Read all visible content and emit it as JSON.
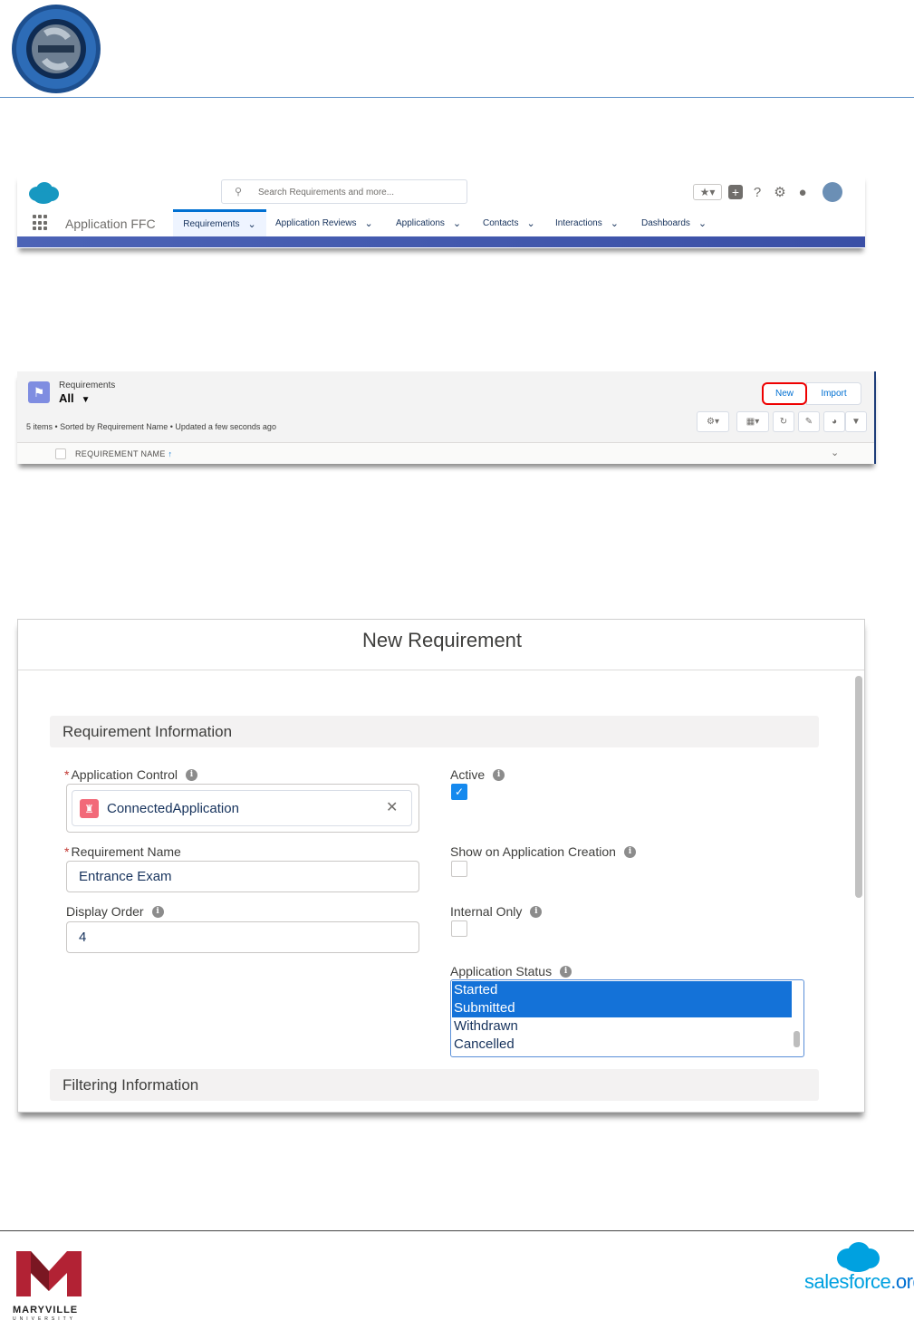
{
  "colors": {
    "brand_blue": "#0070d2",
    "nav_band": "#3a4fa6",
    "highlight_red": "#e00000",
    "selected_option": "#1472d8",
    "object_icon": "#7f8de1",
    "lookup_icon": "#f26979"
  },
  "top_nav": {
    "search_placeholder": "Search Requirements and more...",
    "app_name": "Application FFC",
    "tabs": [
      {
        "label": "Requirements",
        "active": true
      },
      {
        "label": "Application Reviews"
      },
      {
        "label": "Applications"
      },
      {
        "label": "Contacts"
      },
      {
        "label": "Interactions"
      },
      {
        "label": "Dashboards"
      }
    ],
    "icons": [
      "favorites-icon",
      "global-add-icon",
      "help-icon",
      "setup-gear-icon",
      "notifications-bell-icon",
      "user-avatar"
    ]
  },
  "list_view": {
    "object_label": "Requirements",
    "view_name": "All",
    "meta": "5 items • Sorted by Requirement Name • Updated a few seconds ago",
    "new_button": "New",
    "import_button": "Import",
    "column_header": "REQUIREMENT NAME",
    "sort_indicator": "↑"
  },
  "modal": {
    "title": "New Requirement",
    "section_requirement": "Requirement Information",
    "section_filtering": "Filtering Information",
    "fields": {
      "application_control": {
        "label": "Application Control",
        "value": "ConnectedApplication"
      },
      "requirement_name": {
        "label": "Requirement Name",
        "value": "Entrance Exam"
      },
      "display_order": {
        "label": "Display Order",
        "value": "4"
      },
      "active": {
        "label": "Active",
        "checked": true
      },
      "show_on_creation": {
        "label": "Show on Application Creation",
        "checked": false
      },
      "internal_only": {
        "label": "Internal Only",
        "checked": false
      },
      "application_status": {
        "label": "Application Status",
        "options": [
          {
            "label": "Started",
            "selected": true
          },
          {
            "label": "Submitted",
            "selected": true
          },
          {
            "label": "Withdrawn",
            "selected": false
          },
          {
            "label": "Cancelled",
            "selected": false
          }
        ]
      }
    }
  },
  "footer": {
    "university_name": "MARYVILLE",
    "university_sub": "UNIVERSITY",
    "partner_text": "salesforce",
    "partner_suffix": ".org"
  }
}
